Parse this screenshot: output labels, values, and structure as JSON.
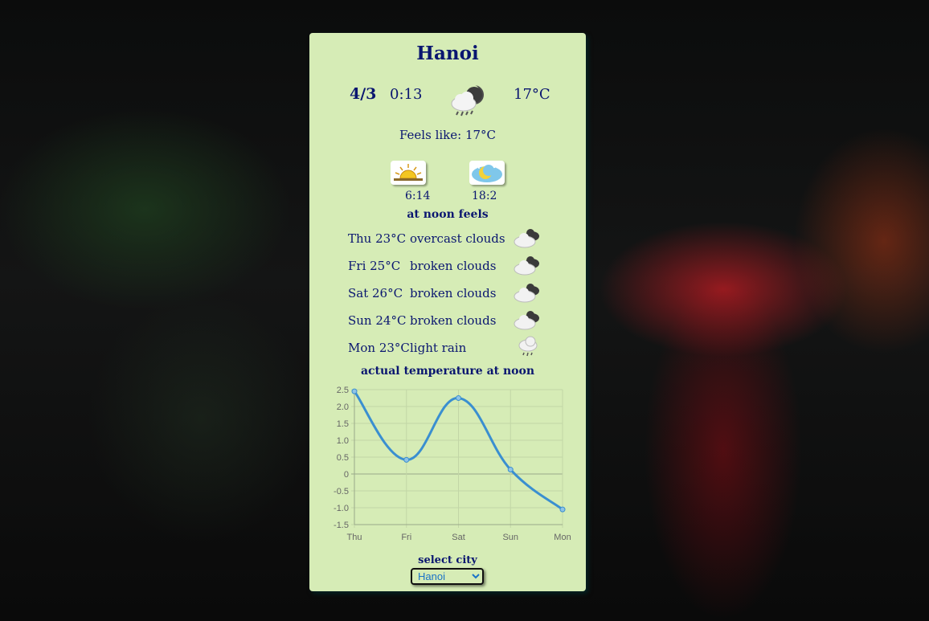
{
  "city": "Hanoi",
  "current": {
    "date": "4/3",
    "time": "0:13",
    "temperature": "17°C",
    "icon": "night-rain-cloud-icon",
    "feels_like": "Feels like: 17°C"
  },
  "sun": {
    "sunrise_icon": "sunrise-icon",
    "sunset_icon": "sunset-moon-icon",
    "sunrise": "6:14",
    "sunset": "18:2"
  },
  "forecast_title": "at noon feels",
  "forecast": [
    {
      "day": "Thu 23°C",
      "desc": "overcast clouds",
      "icon": "overcast-clouds-icon"
    },
    {
      "day": "Fri 25°C",
      "desc": "broken clouds",
      "icon": "broken-clouds-icon"
    },
    {
      "day": "Sat 26°C",
      "desc": "broken clouds",
      "icon": "broken-clouds-icon"
    },
    {
      "day": "Sun 24°C",
      "desc": "broken clouds",
      "icon": "broken-clouds-icon"
    },
    {
      "day": "Mon 23°C",
      "desc": "light rain",
      "icon": "light-rain-icon"
    }
  ],
  "chart_title": "actual temperature at noon",
  "chart_data": {
    "type": "line",
    "title": "actual temperature at noon",
    "categories": [
      "Thu",
      "Fri",
      "Sat",
      "Sun",
      "Mon"
    ],
    "values": [
      2.45,
      0.42,
      2.25,
      0.13,
      -1.05
    ],
    "ylim": [
      -1.5,
      2.5
    ],
    "yticks": [
      "2.5",
      "2.0",
      "1.5",
      "1.0",
      "0.5",
      "0",
      "-0.5",
      "-1.0",
      "-1.5"
    ],
    "grid": true,
    "line_color": "#3a8fd0"
  },
  "select": {
    "label": "select city",
    "value": "Hanoi"
  },
  "colors": {
    "card_bg": "#d6ecb6",
    "text": "#0a1670"
  }
}
